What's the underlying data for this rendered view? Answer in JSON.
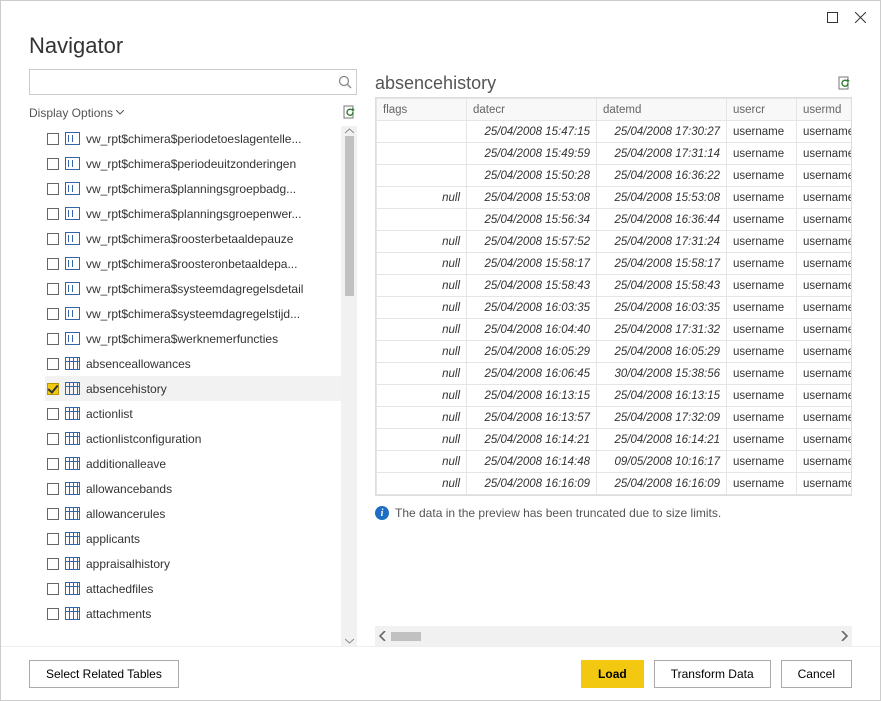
{
  "window": {
    "title": "Navigator"
  },
  "search": {
    "placeholder": ""
  },
  "displayOptions": {
    "label": "Display Options"
  },
  "treeItems": [
    {
      "checked": false,
      "icon": "view",
      "label": "vw_rpt$chimera$periodetoeslagentelle..."
    },
    {
      "checked": false,
      "icon": "view",
      "label": "vw_rpt$chimera$periodeuitzonderingen"
    },
    {
      "checked": false,
      "icon": "view",
      "label": "vw_rpt$chimera$planningsgroepbadg..."
    },
    {
      "checked": false,
      "icon": "view",
      "label": "vw_rpt$chimera$planningsgroepenwer..."
    },
    {
      "checked": false,
      "icon": "view",
      "label": "vw_rpt$chimera$roosterbetaaldepauze"
    },
    {
      "checked": false,
      "icon": "view",
      "label": "vw_rpt$chimera$roosteronbetaaldepa..."
    },
    {
      "checked": false,
      "icon": "view",
      "label": "vw_rpt$chimera$systeemdagregelsdetail"
    },
    {
      "checked": false,
      "icon": "view",
      "label": "vw_rpt$chimera$systeemdagregelstijd..."
    },
    {
      "checked": false,
      "icon": "view",
      "label": "vw_rpt$chimera$werknemerfuncties"
    },
    {
      "checked": false,
      "icon": "table",
      "label": "absenceallowances"
    },
    {
      "checked": true,
      "icon": "table",
      "label": "absencehistory",
      "selected": true
    },
    {
      "checked": false,
      "icon": "table",
      "label": "actionlist"
    },
    {
      "checked": false,
      "icon": "table",
      "label": "actionlistconfiguration"
    },
    {
      "checked": false,
      "icon": "table",
      "label": "additionalleave"
    },
    {
      "checked": false,
      "icon": "table",
      "label": "allowancebands"
    },
    {
      "checked": false,
      "icon": "table",
      "label": "allowancerules"
    },
    {
      "checked": false,
      "icon": "table",
      "label": "applicants"
    },
    {
      "checked": false,
      "icon": "table",
      "label": "appraisalhistory"
    },
    {
      "checked": false,
      "icon": "table",
      "label": "attachedfiles"
    },
    {
      "checked": false,
      "icon": "table",
      "label": "attachments"
    }
  ],
  "preview": {
    "title": "absencehistory",
    "columns": [
      "flags",
      "datecr",
      "datemd",
      "usercr",
      "usermd"
    ],
    "rows": [
      {
        "flags": "",
        "datecr": "25/04/2008 15:47:15",
        "datemd": "25/04/2008 17:30:27",
        "usercr": "username",
        "usermd": "username"
      },
      {
        "flags": "",
        "datecr": "25/04/2008 15:49:59",
        "datemd": "25/04/2008 17:31:14",
        "usercr": "username",
        "usermd": "username"
      },
      {
        "flags": "",
        "datecr": "25/04/2008 15:50:28",
        "datemd": "25/04/2008 16:36:22",
        "usercr": "username",
        "usermd": "username"
      },
      {
        "flags": "null",
        "datecr": "25/04/2008 15:53:08",
        "datemd": "25/04/2008 15:53:08",
        "usercr": "username",
        "usermd": "username"
      },
      {
        "flags": "",
        "datecr": "25/04/2008 15:56:34",
        "datemd": "25/04/2008 16:36:44",
        "usercr": "username",
        "usermd": "username"
      },
      {
        "flags": "null",
        "datecr": "25/04/2008 15:57:52",
        "datemd": "25/04/2008 17:31:24",
        "usercr": "username",
        "usermd": "username"
      },
      {
        "flags": "null",
        "datecr": "25/04/2008 15:58:17",
        "datemd": "25/04/2008 15:58:17",
        "usercr": "username",
        "usermd": "username"
      },
      {
        "flags": "null",
        "datecr": "25/04/2008 15:58:43",
        "datemd": "25/04/2008 15:58:43",
        "usercr": "username",
        "usermd": "username"
      },
      {
        "flags": "null",
        "datecr": "25/04/2008 16:03:35",
        "datemd": "25/04/2008 16:03:35",
        "usercr": "username",
        "usermd": "username"
      },
      {
        "flags": "null",
        "datecr": "25/04/2008 16:04:40",
        "datemd": "25/04/2008 17:31:32",
        "usercr": "username",
        "usermd": "username"
      },
      {
        "flags": "null",
        "datecr": "25/04/2008 16:05:29",
        "datemd": "25/04/2008 16:05:29",
        "usercr": "username",
        "usermd": "username"
      },
      {
        "flags": "null",
        "datecr": "25/04/2008 16:06:45",
        "datemd": "30/04/2008 15:38:56",
        "usercr": "username",
        "usermd": "username"
      },
      {
        "flags": "null",
        "datecr": "25/04/2008 16:13:15",
        "datemd": "25/04/2008 16:13:15",
        "usercr": "username",
        "usermd": "username"
      },
      {
        "flags": "null",
        "datecr": "25/04/2008 16:13:57",
        "datemd": "25/04/2008 17:32:09",
        "usercr": "username",
        "usermd": "username"
      },
      {
        "flags": "null",
        "datecr": "25/04/2008 16:14:21",
        "datemd": "25/04/2008 16:14:21",
        "usercr": "username",
        "usermd": "username"
      },
      {
        "flags": "null",
        "datecr": "25/04/2008 16:14:48",
        "datemd": "09/05/2008 10:16:17",
        "usercr": "username",
        "usermd": "username"
      },
      {
        "flags": "null",
        "datecr": "25/04/2008 16:16:09",
        "datemd": "25/04/2008 16:16:09",
        "usercr": "username",
        "usermd": "username"
      }
    ],
    "truncatedMsg": "The data in the preview has been truncated due to size limits."
  },
  "footer": {
    "selectRelated": "Select Related Tables",
    "load": "Load",
    "transform": "Transform Data",
    "cancel": "Cancel"
  }
}
